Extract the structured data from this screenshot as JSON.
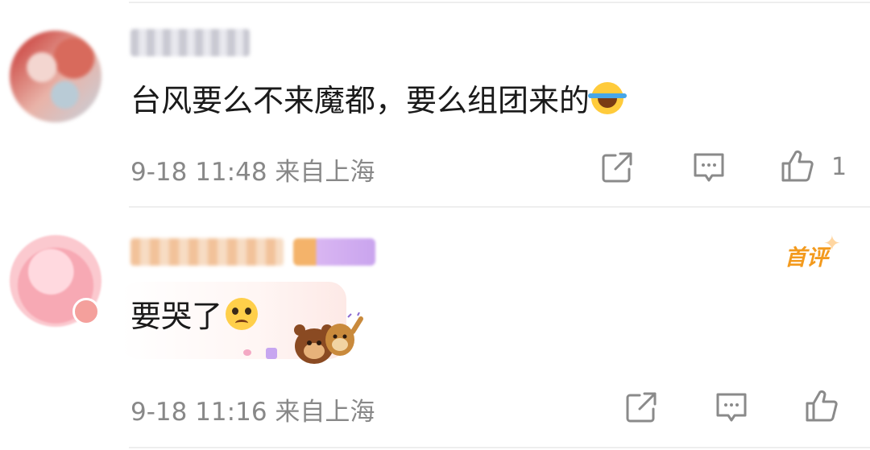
{
  "comments": [
    {
      "username": "",
      "text": "台风要么不来魔都，要么组团来的",
      "emoji": "laughing-tears-emoji",
      "meta": "9-18 11:48 来自上海",
      "likes": "1"
    },
    {
      "username": "",
      "badge": "首评",
      "text": "要哭了",
      "emoji": "pleading-face-emoji",
      "meta": "9-18 11:16 来自上海",
      "likes": ""
    }
  ],
  "icons": {
    "share": "share-icon",
    "comment": "comment-icon",
    "like": "thumbs-up-icon"
  },
  "colors": {
    "meta_text": "#888888",
    "badge": "#f39a1d",
    "separator": "#eeeeee"
  }
}
